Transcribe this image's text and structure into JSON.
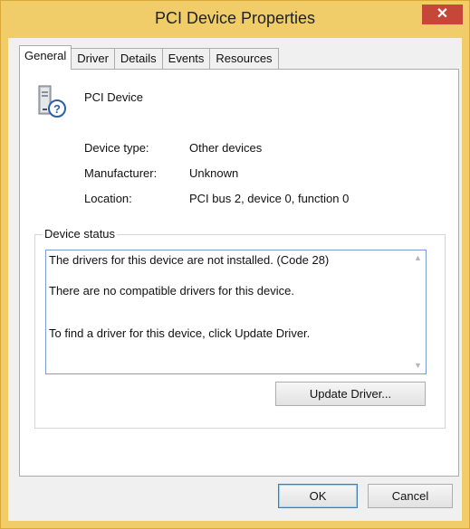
{
  "window": {
    "title": "PCI Device Properties",
    "close_symbol": "✕"
  },
  "tabs": [
    {
      "label": "General",
      "active": true
    },
    {
      "label": "Driver",
      "active": false
    },
    {
      "label": "Details",
      "active": false
    },
    {
      "label": "Events",
      "active": false
    },
    {
      "label": "Resources",
      "active": false
    }
  ],
  "device": {
    "name": "PCI Device",
    "icon": "unknown-device-icon",
    "properties": [
      {
        "label": "Device type:",
        "value": "Other devices"
      },
      {
        "label": "Manufacturer:",
        "value": "Unknown"
      },
      {
        "label": "Location:",
        "value": "PCI bus 2, device 0, function 0"
      }
    ]
  },
  "status": {
    "legend": "Device status",
    "lines": [
      "The drivers for this device are not installed. (Code 28)",
      "There are no compatible drivers for this device.",
      "To find a driver for this device, click Update Driver."
    ],
    "scroll_up": "▲",
    "scroll_down": "▼"
  },
  "buttons": {
    "update_driver": "Update Driver...",
    "ok": "OK",
    "cancel": "Cancel"
  },
  "colors": {
    "titlebar": "#f1cd6a",
    "close": "#c7463a",
    "focus_border": "#7a9cd3"
  }
}
